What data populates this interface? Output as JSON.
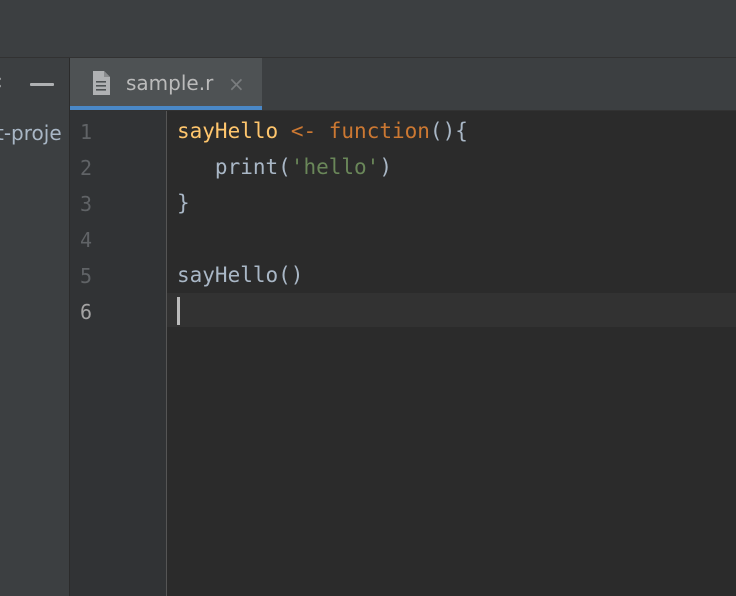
{
  "sidebar": {
    "collapse_glyph": "‹",
    "project_name": "t-proje"
  },
  "tabs": [
    {
      "label": "sample.r",
      "close_glyph": "×",
      "active": true,
      "icon": "file-icon"
    }
  ],
  "editor": {
    "line_numbers": [
      "1",
      "2",
      "3",
      "4",
      "5",
      "6"
    ],
    "current_line": "6",
    "lines": [
      {
        "tokens": [
          {
            "type": "fn",
            "text": "sayHello"
          },
          {
            "type": "plain",
            "text": " "
          },
          {
            "type": "op",
            "text": "<-"
          },
          {
            "type": "plain",
            "text": " "
          },
          {
            "type": "kw",
            "text": "function"
          },
          {
            "type": "plain",
            "text": "(){"
          }
        ]
      },
      {
        "tokens": [
          {
            "type": "plain",
            "text": "   print("
          },
          {
            "type": "str",
            "text": "'hello'"
          },
          {
            "type": "plain",
            "text": ")"
          }
        ]
      },
      {
        "tokens": [
          {
            "type": "plain",
            "text": "}"
          }
        ]
      },
      {
        "tokens": []
      },
      {
        "tokens": [
          {
            "type": "plain",
            "text": "sayHello()"
          }
        ]
      },
      {
        "tokens": []
      }
    ]
  },
  "colors": {
    "accent": "#4a88c7",
    "function_name": "#ffc66d",
    "keyword": "#cc7832",
    "string": "#6a8759",
    "text": "#a9b7c6"
  }
}
